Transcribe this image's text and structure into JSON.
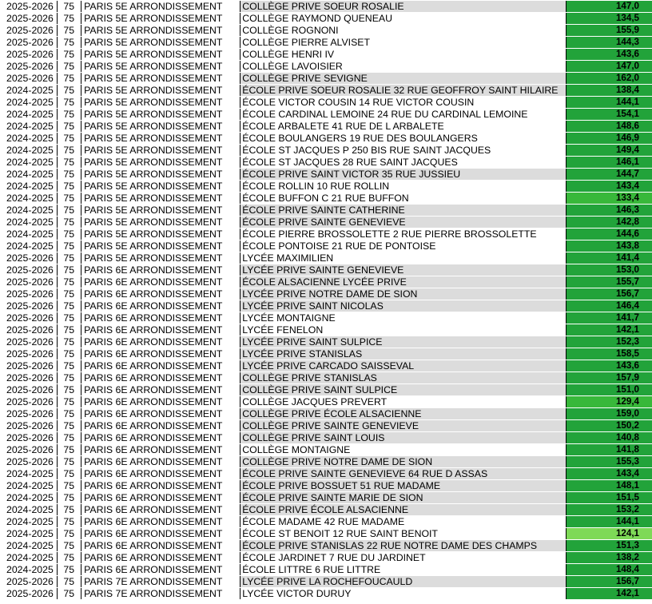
{
  "colors": {
    "score_base": "#22a33a",
    "score_light": "#38b83a",
    "score_lighter": "#7ed957",
    "shade": "#dcdcdc"
  },
  "rows": [
    {
      "year": "2025-2026",
      "dep": "75",
      "city": "PARIS 5E ARRONDISSEMENT",
      "name": "COLLÈGE PRIVE SOEUR ROSALIE",
      "score": "147,0",
      "shaded": true
    },
    {
      "year": "2025-2026",
      "dep": "75",
      "city": "PARIS 5E ARRONDISSEMENT",
      "name": "COLLÈGE RAYMOND QUENEAU",
      "score": "134,5",
      "shaded": false
    },
    {
      "year": "2025-2026",
      "dep": "75",
      "city": "PARIS 5E ARRONDISSEMENT",
      "name": "COLLÈGE ROGNONI",
      "score": "155,9",
      "shaded": false
    },
    {
      "year": "2025-2026",
      "dep": "75",
      "city": "PARIS 5E ARRONDISSEMENT",
      "name": "COLLÈGE PIERRE ALVISET",
      "score": "144,3",
      "shaded": false
    },
    {
      "year": "2025-2026",
      "dep": "75",
      "city": "PARIS 5E ARRONDISSEMENT",
      "name": "COLLÈGE HENRI IV",
      "score": "143,6",
      "shaded": false
    },
    {
      "year": "2025-2026",
      "dep": "75",
      "city": "PARIS 5E ARRONDISSEMENT",
      "name": "COLLÈGE LAVOISIER",
      "score": "147,0",
      "shaded": false
    },
    {
      "year": "2025-2026",
      "dep": "75",
      "city": "PARIS 5E ARRONDISSEMENT",
      "name": "COLLÈGE PRIVE SEVIGNE",
      "score": "162,0",
      "shaded": true
    },
    {
      "year": "2024-2025",
      "dep": "75",
      "city": "PARIS 5E ARRONDISSEMENT",
      "name": "ÉCOLE PRIVE SOEUR ROSALIE 32 RUE GEOFFROY SAINT HILAIRE",
      "score": "138,4",
      "shaded": true
    },
    {
      "year": "2024-2025",
      "dep": "75",
      "city": "PARIS 5E ARRONDISSEMENT",
      "name": "ÉCOLE VICTOR COUSIN 14 RUE VICTOR COUSIN",
      "score": "144,1",
      "shaded": false
    },
    {
      "year": "2024-2025",
      "dep": "75",
      "city": "PARIS 5E ARRONDISSEMENT",
      "name": "ÉCOLE CARDINAL LEMOINE 24 RUE DU CARDINAL LEMOINE",
      "score": "154,1",
      "shaded": false
    },
    {
      "year": "2024-2025",
      "dep": "75",
      "city": "PARIS 5E ARRONDISSEMENT",
      "name": "ÉCOLE ARBALETE 41 RUE DE L ARBALETE",
      "score": "148,6",
      "shaded": false
    },
    {
      "year": "2024-2025",
      "dep": "75",
      "city": "PARIS 5E ARRONDISSEMENT",
      "name": "ÉCOLE BOULANGERS 19 RUE DES BOULANGERS",
      "score": "146,9",
      "shaded": false
    },
    {
      "year": "2024-2025",
      "dep": "75",
      "city": "PARIS 5E ARRONDISSEMENT",
      "name": "ÉCOLE ST JACQUES P 250 BIS RUE SAINT JACQUES",
      "score": "149,4",
      "shaded": false
    },
    {
      "year": "2024-2025",
      "dep": "75",
      "city": "PARIS 5E ARRONDISSEMENT",
      "name": "ÉCOLE ST JACQUES 28 RUE SAINT JACQUES",
      "score": "146,1",
      "shaded": false
    },
    {
      "year": "2024-2025",
      "dep": "75",
      "city": "PARIS 5E ARRONDISSEMENT",
      "name": "ÉCOLE PRIVE SAINT VICTOR 35 RUE JUSSIEU",
      "score": "144,7",
      "shaded": true
    },
    {
      "year": "2024-2025",
      "dep": "75",
      "city": "PARIS 5E ARRONDISSEMENT",
      "name": "ÉCOLE ROLLIN 10 RUE ROLLIN",
      "score": "143,4",
      "shaded": false
    },
    {
      "year": "2024-2025",
      "dep": "75",
      "city": "PARIS 5E ARRONDISSEMENT",
      "name": "ÉCOLE BUFFON C 21 RUE BUFFON",
      "score": "133,4",
      "shaded": false
    },
    {
      "year": "2024-2025",
      "dep": "75",
      "city": "PARIS 5E ARRONDISSEMENT",
      "name": "ÉCOLE PRIVE SAINTE CATHERINE",
      "score": "146,3",
      "shaded": true
    },
    {
      "year": "2024-2025",
      "dep": "75",
      "city": "PARIS 5E ARRONDISSEMENT",
      "name": "ÉCOLE PRIVE SAINTE GENEVIEVE",
      "score": "142,8",
      "shaded": true
    },
    {
      "year": "2024-2025",
      "dep": "75",
      "city": "PARIS 5E ARRONDISSEMENT",
      "name": "ÉCOLE PIERRE BROSSOLETTE 2 RUE PIERRE BROSSOLETTE",
      "score": "144,6",
      "shaded": false
    },
    {
      "year": "2024-2025",
      "dep": "75",
      "city": "PARIS 5E ARRONDISSEMENT",
      "name": "ÉCOLE PONTOISE 21 RUE DE PONTOISE",
      "score": "143,8",
      "shaded": false
    },
    {
      "year": "2025-2026",
      "dep": "75",
      "city": "PARIS 5E ARRONDISSEMENT",
      "name": "LYCÉE MAXIMILIEN",
      "score": "141,4",
      "shaded": false
    },
    {
      "year": "2025-2026",
      "dep": "75",
      "city": "PARIS 6E ARRONDISSEMENT",
      "name": "LYCÉE PRIVE SAINTE GENEVIEVE",
      "score": "153,0",
      "shaded": true
    },
    {
      "year": "2025-2026",
      "dep": "75",
      "city": "PARIS 6E ARRONDISSEMENT",
      "name": "ÉCOLE ALSACIENNE LYCÉE PRIVE",
      "score": "155,7",
      "shaded": true
    },
    {
      "year": "2025-2026",
      "dep": "75",
      "city": "PARIS 6E ARRONDISSEMENT",
      "name": "LYCÉE PRIVE NOTRE DAME DE SION",
      "score": "156,7",
      "shaded": true
    },
    {
      "year": "2025-2026",
      "dep": "75",
      "city": "PARIS 6E ARRONDISSEMENT",
      "name": "LYCÉE PRIVE SAINT NICOLAS",
      "score": "146,4",
      "shaded": true
    },
    {
      "year": "2025-2026",
      "dep": "75",
      "city": "PARIS 6E ARRONDISSEMENT",
      "name": "LYCÉE MONTAIGNE",
      "score": "141,7",
      "shaded": false
    },
    {
      "year": "2025-2026",
      "dep": "75",
      "city": "PARIS 6E ARRONDISSEMENT",
      "name": "LYCÉE FENELON",
      "score": "142,1",
      "shaded": false
    },
    {
      "year": "2025-2026",
      "dep": "75",
      "city": "PARIS 6E ARRONDISSEMENT",
      "name": "LYCÉE PRIVE SAINT SULPICE",
      "score": "152,3",
      "shaded": true
    },
    {
      "year": "2025-2026",
      "dep": "75",
      "city": "PARIS 6E ARRONDISSEMENT",
      "name": "LYCÉE PRIVE STANISLAS",
      "score": "158,5",
      "shaded": true
    },
    {
      "year": "2025-2026",
      "dep": "75",
      "city": "PARIS 6E ARRONDISSEMENT",
      "name": "LYCÉE PRIVE CARCADO SAISSEVAL",
      "score": "143,6",
      "shaded": true
    },
    {
      "year": "2025-2026",
      "dep": "75",
      "city": "PARIS 6E ARRONDISSEMENT",
      "name": "COLLÈGE PRIVE STANISLAS",
      "score": "157,9",
      "shaded": true
    },
    {
      "year": "2025-2026",
      "dep": "75",
      "city": "PARIS 6E ARRONDISSEMENT",
      "name": "COLLÈGE PRIVE SAINT SULPICE",
      "score": "151,0",
      "shaded": true
    },
    {
      "year": "2025-2026",
      "dep": "75",
      "city": "PARIS 6E ARRONDISSEMENT",
      "name": "COLLÈGE JACQUES PREVERT",
      "score": "129,4",
      "shaded": false
    },
    {
      "year": "2025-2026",
      "dep": "75",
      "city": "PARIS 6E ARRONDISSEMENT",
      "name": "COLLÈGE PRIVE ÉCOLE ALSACIENNE",
      "score": "159,0",
      "shaded": true
    },
    {
      "year": "2025-2026",
      "dep": "75",
      "city": "PARIS 6E ARRONDISSEMENT",
      "name": "COLLÈGE PRIVE SAINTE GENEVIEVE",
      "score": "150,2",
      "shaded": true
    },
    {
      "year": "2025-2026",
      "dep": "75",
      "city": "PARIS 6E ARRONDISSEMENT",
      "name": "COLLÈGE PRIVE SAINT LOUIS",
      "score": "140,8",
      "shaded": true
    },
    {
      "year": "2025-2026",
      "dep": "75",
      "city": "PARIS 6E ARRONDISSEMENT",
      "name": "COLLÈGE MONTAIGNE",
      "score": "141,8",
      "shaded": false
    },
    {
      "year": "2025-2026",
      "dep": "75",
      "city": "PARIS 6E ARRONDISSEMENT",
      "name": "COLLÈGE PRIVE NOTRE DAME DE SION",
      "score": "155,3",
      "shaded": true
    },
    {
      "year": "2024-2025",
      "dep": "75",
      "city": "PARIS 6E ARRONDISSEMENT",
      "name": "ÉCOLE PRIVE SAINTE GENEVIEVE 64 RUE D ASSAS",
      "score": "143,4",
      "shaded": true
    },
    {
      "year": "2024-2025",
      "dep": "75",
      "city": "PARIS 6E ARRONDISSEMENT",
      "name": "ÉCOLE PRIVE BOSSUET 51 RUE MADAME",
      "score": "148,1",
      "shaded": true
    },
    {
      "year": "2024-2025",
      "dep": "75",
      "city": "PARIS 6E ARRONDISSEMENT",
      "name": "ÉCOLE PRIVE SAINTE MARIE DE SION",
      "score": "151,5",
      "shaded": true
    },
    {
      "year": "2024-2025",
      "dep": "75",
      "city": "PARIS 6E ARRONDISSEMENT",
      "name": "ÉCOLE PRIVE ÉCOLE ALSACIENNE",
      "score": "153,2",
      "shaded": true
    },
    {
      "year": "2024-2025",
      "dep": "75",
      "city": "PARIS 6E ARRONDISSEMENT",
      "name": "ÉCOLE MADAME 42 RUE MADAME",
      "score": "144,1",
      "shaded": false
    },
    {
      "year": "2024-2025",
      "dep": "75",
      "city": "PARIS 6E ARRONDISSEMENT",
      "name": "ÉCOLE ST BENOIT 12 RUE SAINT BENOIT",
      "score": "124,1",
      "shaded": false
    },
    {
      "year": "2024-2025",
      "dep": "75",
      "city": "PARIS 6E ARRONDISSEMENT",
      "name": "ÉCOLE PRIVE STANISLAS 22 RUE NOTRE DAME DES CHAMPS",
      "score": "151,3",
      "shaded": true
    },
    {
      "year": "2024-2025",
      "dep": "75",
      "city": "PARIS 6E ARRONDISSEMENT",
      "name": "ÉCOLE JARDINET 7 RUE DU JARDINET",
      "score": "138,2",
      "shaded": false
    },
    {
      "year": "2024-2025",
      "dep": "75",
      "city": "PARIS 6E ARRONDISSEMENT",
      "name": "ÉCOLE LITTRE 6 RUE LITTRE",
      "score": "148,4",
      "shaded": false
    },
    {
      "year": "2025-2026",
      "dep": "75",
      "city": "PARIS 7E ARRONDISSEMENT",
      "name": "LYCÉE PRIVE LA ROCHEFOUCAULD",
      "score": "156,7",
      "shaded": true
    },
    {
      "year": "2025-2026",
      "dep": "75",
      "city": "PARIS 7E ARRONDISSEMENT",
      "name": "LYCÉE VICTOR DURUY",
      "score": "142,1",
      "shaded": false
    }
  ]
}
